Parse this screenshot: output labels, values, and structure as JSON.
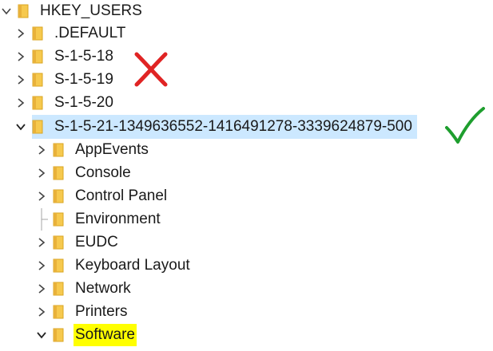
{
  "root": {
    "label": "HKEY_USERS",
    "icon": "folder-icon",
    "expanded": true
  },
  "users": [
    {
      "label": ".DEFAULT",
      "icon": "folder-icon",
      "expanded": false
    },
    {
      "label": "S-1-5-18",
      "icon": "folder-icon",
      "expanded": false
    },
    {
      "label": "S-1-5-19",
      "icon": "folder-icon",
      "expanded": false
    },
    {
      "label": "S-1-5-20",
      "icon": "folder-icon",
      "expanded": false
    },
    {
      "label": "S-1-5-21-1349636552-1416491278-3339624879-500",
      "icon": "folder-icon",
      "expanded": true,
      "selected": true
    }
  ],
  "subkeys": [
    {
      "label": "AppEvents",
      "expandable": true
    },
    {
      "label": "Console",
      "expandable": true
    },
    {
      "label": "Control Panel",
      "expandable": true
    },
    {
      "label": "Environment",
      "expandable": false
    },
    {
      "label": "EUDC",
      "expandable": true
    },
    {
      "label": "Keyboard Layout",
      "expandable": true
    },
    {
      "label": "Network",
      "expandable": true
    },
    {
      "label": "Printers",
      "expandable": true
    },
    {
      "label": "Software",
      "expandable": true,
      "expanded": true,
      "highlighted": true
    }
  ],
  "annotations": {
    "cross_icon": "red-x-icon",
    "check_icon": "green-checkmark-icon"
  },
  "colors": {
    "selection": "#cce8ff",
    "highlight": "#ffff00",
    "folder": "#f6c94e",
    "cross": "#e02424",
    "check": "#1e9e2e"
  }
}
